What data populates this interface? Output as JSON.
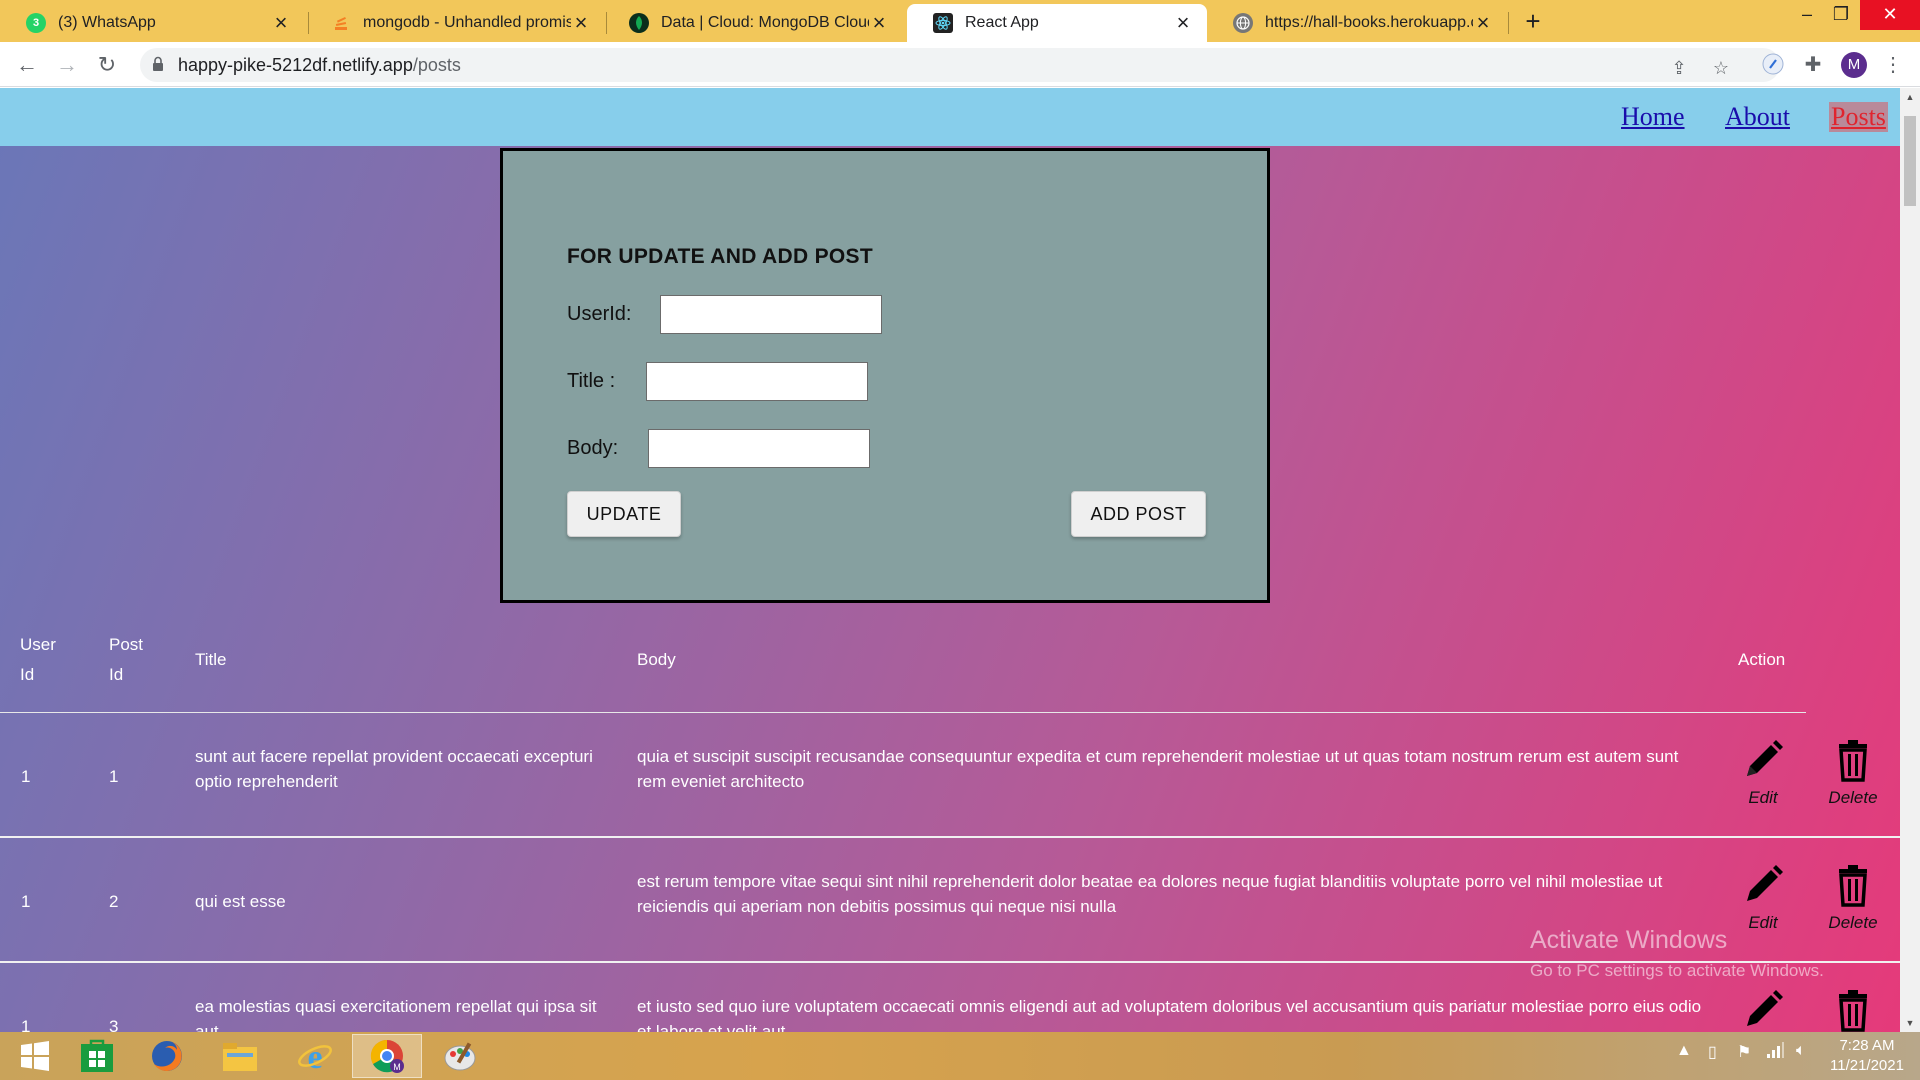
{
  "browser": {
    "tabs": [
      {
        "title": "(3) WhatsApp",
        "badge": "3"
      },
      {
        "title": "mongodb - Unhandled promise r"
      },
      {
        "title": "Data | Cloud: MongoDB Cloud"
      },
      {
        "title": "React App"
      },
      {
        "title": "https://hall-books.herokuapp.com"
      }
    ],
    "url_host": "happy-pike-5212df.netlify.app",
    "url_path": "/posts",
    "profile_initial": "M"
  },
  "nav": {
    "home": "Home",
    "about": "About",
    "posts": "Posts"
  },
  "form": {
    "heading": "FOR UPDATE AND ADD POST",
    "userid_label": "UserId:",
    "title_label": "Title :",
    "body_label": "Body:",
    "userid_value": "",
    "title_value": "",
    "body_value": "",
    "update_button": "UPDATE",
    "add_button": "ADD POST"
  },
  "table": {
    "headers": {
      "user_id_1": "User",
      "user_id_2": "Id",
      "post_id_1": "Post",
      "post_id_2": "Id",
      "title": "Title",
      "body": "Body",
      "action": "Action"
    },
    "edit_label": "Edit",
    "delete_label": "Delete",
    "rows": [
      {
        "user_id": "1",
        "post_id": "1",
        "title": "sunt aut facere repellat provident occaecati excepturi optio reprehenderit",
        "body": "quia et suscipit suscipit recusandae consequuntur expedita et cum reprehenderit molestiae ut ut quas totam nostrum rerum est autem sunt rem eveniet architecto"
      },
      {
        "user_id": "1",
        "post_id": "2",
        "title": "qui est esse",
        "body": "est rerum tempore vitae sequi sint nihil reprehenderit dolor beatae ea dolores neque fugiat blanditiis voluptate porro vel nihil molestiae ut reiciendis qui aperiam non debitis possimus qui neque nisi nulla"
      },
      {
        "user_id": "1",
        "post_id": "3",
        "title": "ea molestias quasi exercitationem repellat qui ipsa sit aut",
        "body": "et iusto sed quo iure voluptatem occaecati omnis eligendi aut ad voluptatem doloribus vel accusantium quis pariatur molestiae porro eius odio et labore et velit aut"
      }
    ]
  },
  "watermark": {
    "line1": "Activate Windows",
    "line2": "Go to PC settings to activate Windows."
  },
  "taskbar": {
    "time": "7:28 AM",
    "date": "11/21/2021"
  },
  "colors": {
    "nav_bg": "#87ceeb",
    "form_bg": "#86a0a0",
    "gradient_start": "#6a77b8",
    "gradient_end": "#e53a7a",
    "active_link": "#e0242e"
  }
}
